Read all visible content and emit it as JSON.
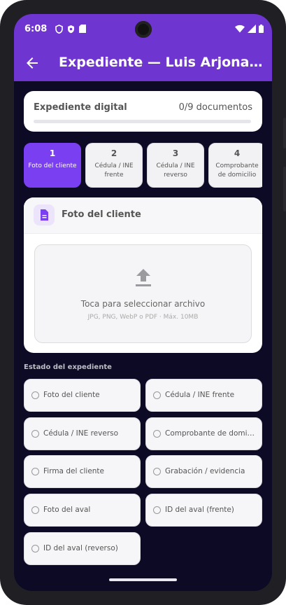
{
  "status_bar": {
    "time": "6:08",
    "left_icons": [
      "shield-outline-icon",
      "shield-check-icon",
      "sd-card-icon"
    ],
    "right_icons": [
      "wifi-icon",
      "cellular-signal-icon",
      "battery-icon"
    ]
  },
  "app_bar": {
    "title": "Expediente — Luis Arjona alberto",
    "back_icon": "arrow-left-icon"
  },
  "progress": {
    "label": "Expediente digital",
    "count": "0/9 documentos",
    "fraction": 0
  },
  "steps": [
    {
      "num": "1",
      "label": "Foto del cliente",
      "active": true
    },
    {
      "num": "2",
      "label": "Cédula / INE frente",
      "active": false
    },
    {
      "num": "3",
      "label": "Cédula / INE reverso",
      "active": false
    },
    {
      "num": "4",
      "label": "Comprobante de domicilio",
      "active": false
    }
  ],
  "upload": {
    "title": "Foto del cliente",
    "icon": "document-icon",
    "dropzone_text": "Toca para seleccionar archivo",
    "dropzone_hint": "JPG, PNG, WebP o PDF · Máx. 10MB",
    "upload_icon": "upload-icon"
  },
  "status_section": {
    "label": "Estado del expediente",
    "items": [
      "Foto del cliente",
      "Cédula / INE frente",
      "Cédula / INE reverso",
      "Comprobante de domicilio",
      "Firma del cliente",
      "Grabación / evidencia",
      "Foto del aval",
      "ID del aval (frente)",
      "ID del aval (reverso)"
    ]
  },
  "colors": {
    "primary": "#6f35d0",
    "step_active": "#7a3ff0",
    "background": "#0c0a24"
  }
}
